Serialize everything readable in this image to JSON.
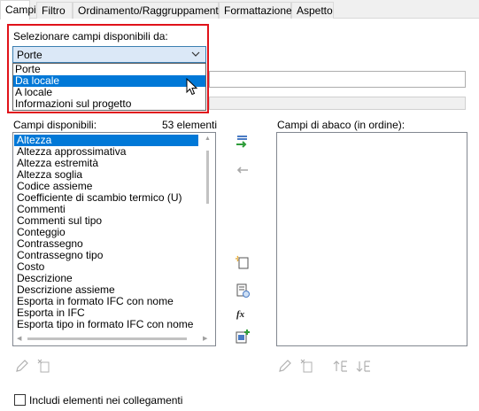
{
  "tabs": [
    {
      "label": "Campi",
      "active": true
    },
    {
      "label": "Filtro",
      "active": false
    },
    {
      "label": "Ordinamento/Raggruppamento",
      "active": false
    },
    {
      "label": "Formattazione",
      "active": false
    },
    {
      "label": "Aspetto",
      "active": false
    }
  ],
  "source": {
    "label": "Selezionare campi disponibili da:",
    "selected": "Porte",
    "options": [
      "Porte",
      "Da locale",
      "A locale",
      "Informazioni sul progetto"
    ],
    "highlighted_option": "Da locale"
  },
  "available": {
    "label": "Campi disponibili:",
    "count": "53 elementi",
    "items": [
      "Altezza",
      "Altezza approssimativa",
      "Altezza estremità",
      "Altezza soglia",
      "Codice assieme",
      "Coefficiente di scambio termico (U)",
      "Commenti",
      "Commenti sul tipo",
      "Conteggio",
      "Contrassegno",
      "Contrassegno tipo",
      "Costo",
      "Descrizione",
      "Descrizione assieme",
      "Esporta in formato IFC con nome",
      "Esporta in IFC",
      "Esporta tipo in formato IFC con nome"
    ],
    "selected_item": "Altezza"
  },
  "schedule": {
    "label": "Campi di abaco (in ordine):",
    "items": []
  },
  "include_links": {
    "label": "Includi elementi nei collegamenti",
    "checked": false
  },
  "colors": {
    "highlight_border": "#e0121a",
    "selection": "#0078d7",
    "select_bg": "#dbe8f7"
  }
}
